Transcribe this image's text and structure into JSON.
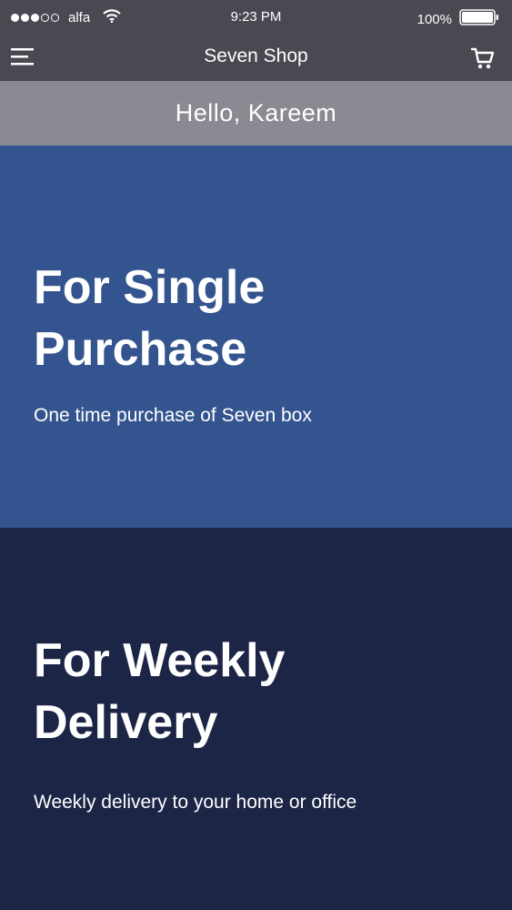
{
  "status_bar": {
    "carrier": "alfa",
    "time": "9:23 PM",
    "battery": "100%",
    "icons": [
      "signal-dots-icon",
      "wifi-icon",
      "battery-icon"
    ]
  },
  "nav": {
    "title": "Seven Shop",
    "icons": [
      "menu-icon",
      "cart-icon"
    ]
  },
  "greeting": "Hello, Kareem",
  "cards": [
    {
      "title": "For Single Purchase",
      "subtitle": "One time purchase of Seven box",
      "color": "#34548f"
    },
    {
      "title": "For Weekly Delivery",
      "subtitle": "Weekly delivery to your home or office",
      "color": "#1c2546"
    }
  ],
  "colors": {
    "header": "#4a4851",
    "greeting": "#8a8a92",
    "text": "#ffffff"
  }
}
